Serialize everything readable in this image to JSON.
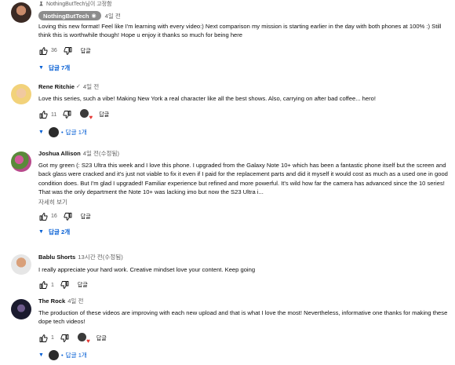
{
  "comments": [
    {
      "pinned_label": "NothingButTech님이 고정함",
      "author": "NothingButTech",
      "time": "4일 전",
      "text": "Loving this new format! Feel like I'm learning with every video:) Next comparison my mission is starting earlier in the day with both phones at 100% :) Still think this is worthwhile though! Hope u enjoy it thanks so much for being here",
      "likes": "36",
      "reply_button": "답글",
      "replies_label": "답글 7개"
    },
    {
      "author": "Rene Ritchie",
      "check": "✓",
      "time": "4일 전",
      "text": "Love this series, such a vibe! Making New York a real character like all the best shows. Also, carrying on after bad coffee... hero!",
      "likes": "11",
      "reply_button": "답글",
      "replies_label": "답글 1개"
    },
    {
      "author": "Joshua Allison",
      "time": "4일 전(수정됨)",
      "text": "Got my green (: S23 Ultra this week and I love this phone. I upgraded from the Galaxy Note 10+ which has been a fantastic phone itself but the screen and back glass were cracked and it's just not viable to fix it even if I paid for the replacement parts and did it myself it would cost as much as a used one in good condition does. But I'm glad I upgraded! Familiar experience but refined and more powerful. It's wild how far the camera has advanced since the 10 series! That was the only department the Note 10+ was lacking imo but now the S23 Ultra i...",
      "read_more": "자세히 보기",
      "likes": "16",
      "reply_button": "답글",
      "replies_label": "답글 2개"
    },
    {
      "author": "Bablu Shorts",
      "time": "13시간 전(수정됨)",
      "text": "I really appreciate your hard work. Creative mindset love your content. Keep going",
      "likes": "1",
      "reply_button": "답글"
    },
    {
      "author": "The Rock",
      "time": "4일 전",
      "text": "The production of these videos are improving with each new upload and that is what I love the most! Nevertheless, informative one thanks for making these dope tech videos!",
      "likes": "1",
      "reply_button": "답글",
      "replies_label": "답글 1개"
    }
  ],
  "colors": {
    "link_blue": "#065fd4",
    "secondary_text": "#606060",
    "author_badge": "#8d8d8d",
    "heart_red": "#e53935"
  }
}
